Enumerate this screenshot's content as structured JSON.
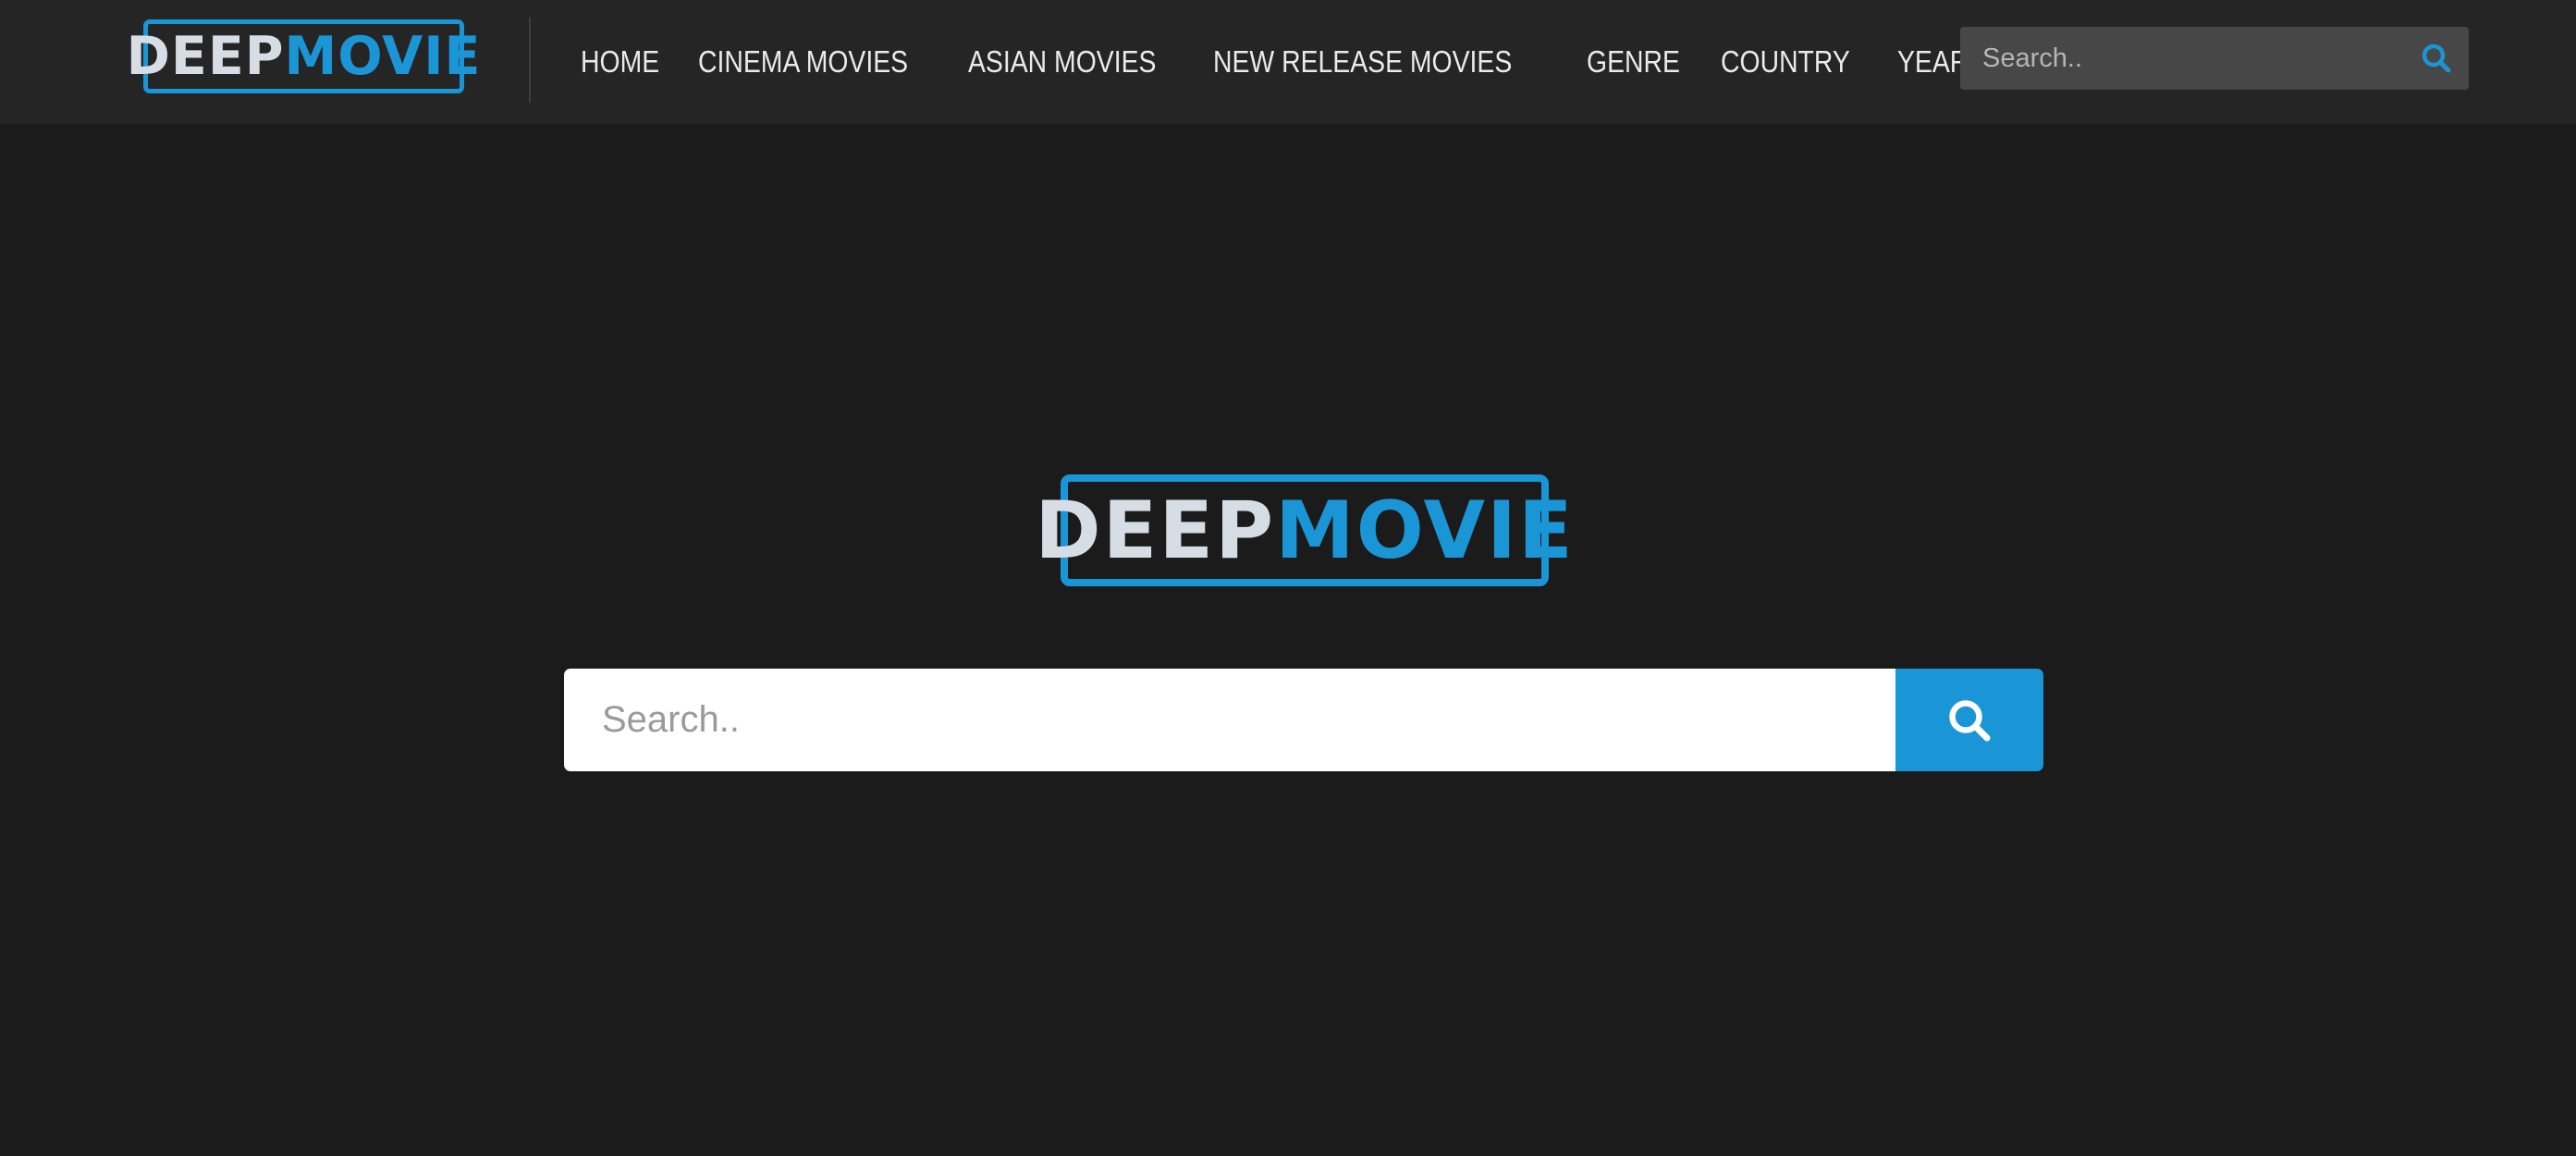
{
  "brand": {
    "name_part1": "DEEP",
    "name_part2": "MOVIE",
    "accent_color": "#1a95d5"
  },
  "nav": {
    "items": [
      {
        "label": "HOME"
      },
      {
        "label": "CINEMA MOVIES"
      },
      {
        "label": "ASIAN MOVIES"
      },
      {
        "label": "NEW RELEASE MOVIES"
      },
      {
        "label": "GENRE"
      },
      {
        "label": "COUNTRY"
      },
      {
        "label": "YEAR"
      }
    ]
  },
  "header_search": {
    "placeholder": "Search..",
    "value": "",
    "icon": "search-icon"
  },
  "hero_search": {
    "placeholder": "Search..",
    "value": "",
    "icon": "search-icon"
  },
  "colors": {
    "background": "#1b1b1b",
    "header_background": "#252525",
    "accent": "#1a95d5"
  }
}
